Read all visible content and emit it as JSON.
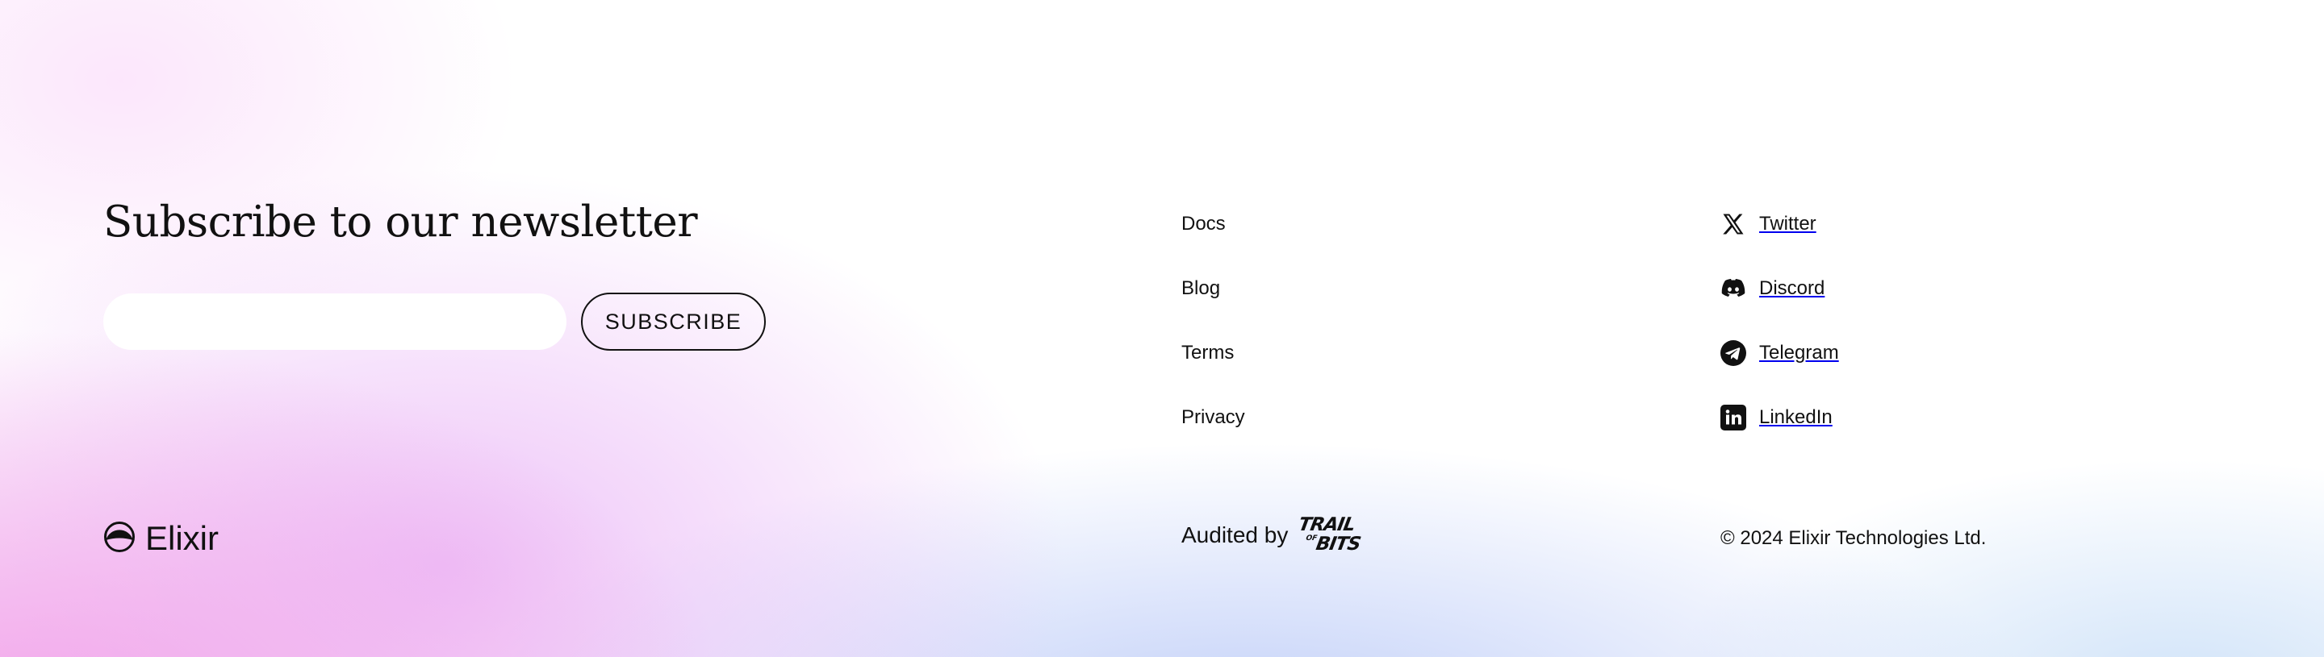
{
  "newsletter": {
    "title": "Subscribe to our newsletter",
    "email_value": "",
    "email_placeholder": "",
    "subscribe_label": "SUBSCRIBE"
  },
  "nav_links": [
    {
      "label": "Docs"
    },
    {
      "label": "Blog"
    },
    {
      "label": "Terms"
    },
    {
      "label": "Privacy"
    }
  ],
  "social_links": [
    {
      "label": "Twitter",
      "icon": "x-twitter-icon"
    },
    {
      "label": "Discord",
      "icon": "discord-icon"
    },
    {
      "label": "Telegram",
      "icon": "telegram-icon"
    },
    {
      "label": "LinkedIn",
      "icon": "linkedin-icon"
    }
  ],
  "brand": {
    "name": "Elixir",
    "icon": "elixir-logo-icon"
  },
  "audit": {
    "label": "Audited by",
    "auditor_logo_text": "TRAIL OF BITS"
  },
  "copyright": "© 2024 Elixir Technologies Ltd.",
  "colors": {
    "text": "#111111",
    "input_bg": "#ffffff",
    "gradient_pink": "#f096e6",
    "gradient_blue": "#becdf8"
  }
}
